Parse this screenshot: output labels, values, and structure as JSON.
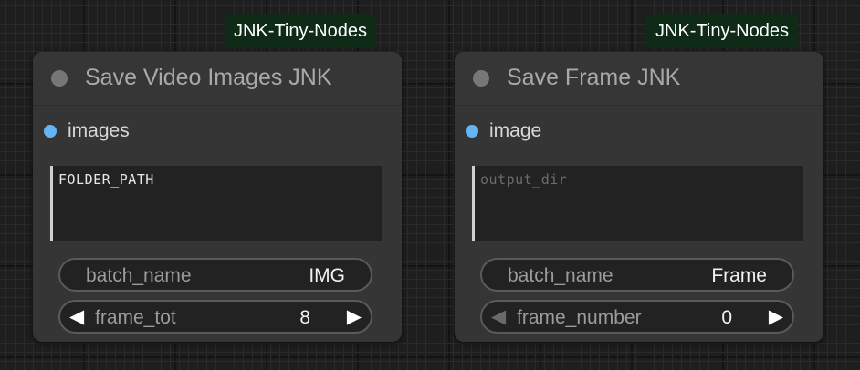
{
  "nodes": [
    {
      "badge": "JNK-Tiny-Nodes",
      "title": "Save Video Images JNK",
      "input_label": "images",
      "textarea_text": "FOLDER_PATH",
      "text_widget": {
        "label": "batch_name",
        "value": "IMG"
      },
      "number_widget": {
        "label": "frame_tot",
        "value": "8",
        "left_arrow": "◀",
        "right_arrow": "▶"
      }
    },
    {
      "badge": "JNK-Tiny-Nodes",
      "title": "Save Frame JNK",
      "input_label": "image",
      "textarea_placeholder": "output_dir",
      "text_widget": {
        "label": "batch_name",
        "value": "Frame"
      },
      "number_widget": {
        "label": "frame_number",
        "value": "0",
        "left_arrow": "◀",
        "right_arrow": "▶"
      }
    }
  ],
  "colors": {
    "canvas": "#1e1e1e",
    "node_bg": "#353535",
    "badge_bg": "#0f2a17",
    "input_slot": "#64b5f6",
    "status_dot": "#777777"
  },
  "icons": {
    "status": "status-dot-icon",
    "input_slot": "input-slot-dot-icon",
    "decrement": "left-arrow-icon",
    "increment": "right-arrow-icon"
  }
}
